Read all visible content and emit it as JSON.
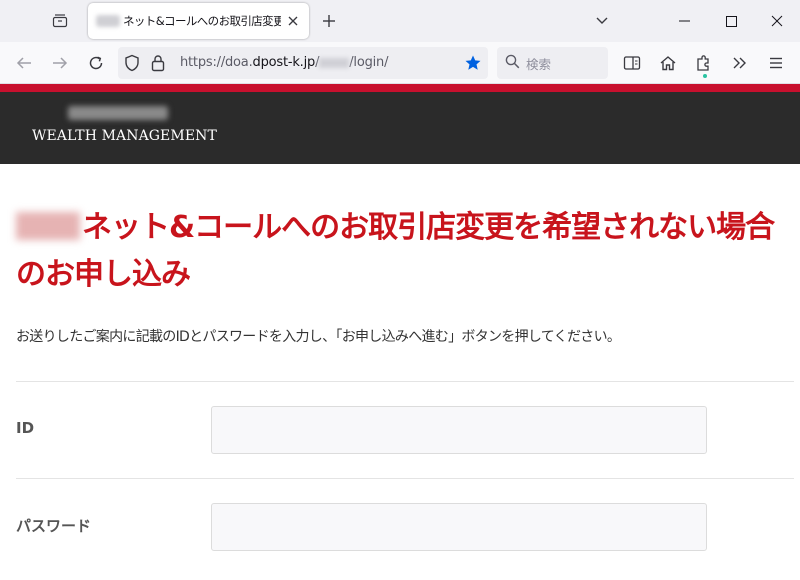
{
  "browser": {
    "tab": {
      "title": "ネット&コールへのお取引店変更を"
    },
    "url": {
      "prefix": "https://doa.",
      "host": "dpost-k.jp",
      "slash": "/",
      "path": "/login/"
    },
    "search": {
      "placeholder": "検索"
    }
  },
  "site": {
    "brand": "WEALTH MANAGEMENT",
    "accent_color": "#c8102e",
    "header_color": "#2b2b2b"
  },
  "page": {
    "title": "ネット&コールへのお取引店変更を希望されない場合のお申し込み",
    "instructions": "お送りしたご案内に記載のIDとパスワードを入力し、「お申し込みへ進む」ボタンを押してください。",
    "fields": {
      "id_label": "ID",
      "id_value": "",
      "password_label": "パスワード",
      "password_value": ""
    }
  }
}
